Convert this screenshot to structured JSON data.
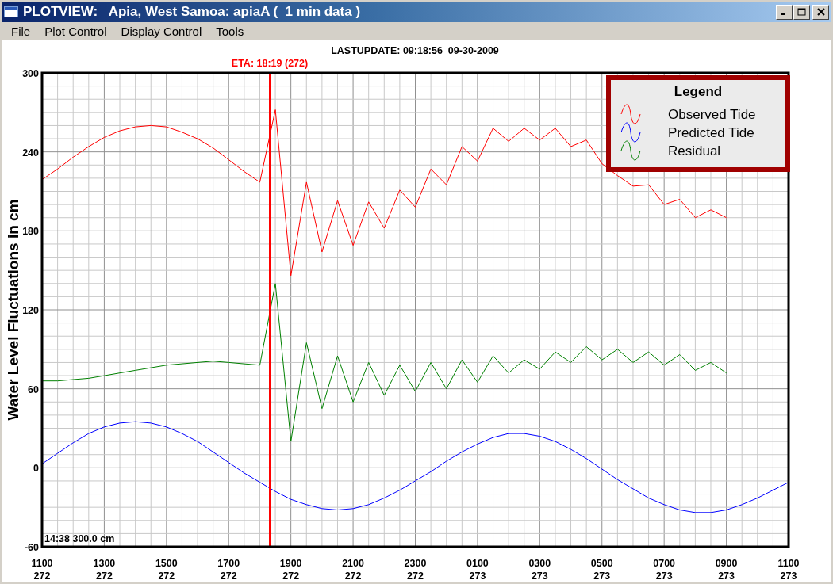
{
  "window": {
    "title": "PLOTVIEW:   Apia, West Samoa: apiaA (  1 min data )"
  },
  "menu": [
    {
      "label": "File"
    },
    {
      "label": "Plot Control"
    },
    {
      "label": "Display Control"
    },
    {
      "label": "Tools"
    }
  ],
  "chart": {
    "readout": "14:38 300.0 cm",
    "legend_title": "Legend",
    "chart_data": {
      "type": "line",
      "title": "LASTUPDATE: 09:18:56  09-30-2009",
      "ylabel": "Water Level Fluctuations in cm",
      "categories": [
        "1100\n272",
        null,
        null,
        null,
        "1300\n272",
        null,
        null,
        null,
        "1500\n272",
        null,
        null,
        null,
        "1700\n272",
        null,
        null,
        null,
        "1900\n272",
        null,
        null,
        null,
        "2100\n272",
        null,
        null,
        null,
        "2300\n272",
        null,
        null,
        null,
        "0100\n273",
        null,
        null,
        null,
        "0300\n273",
        null,
        null,
        null,
        "0500\n273",
        null,
        null,
        null,
        "0700\n273",
        null,
        null,
        null,
        "0900\n273",
        null,
        null,
        null,
        "1100\n273"
      ],
      "series": [
        {
          "name": "Observed Tide",
          "color": "#ff0000",
          "values": [
            219,
            227,
            236,
            244,
            251,
            256,
            259,
            260,
            259,
            255,
            250,
            243,
            234,
            225,
            217,
            272,
            146,
            217,
            164,
            203,
            169,
            202,
            182,
            211,
            198,
            227,
            215,
            244,
            233,
            258,
            248,
            258,
            249,
            258,
            244,
            249,
            231,
            222,
            214,
            215,
            200,
            204,
            190,
            196,
            190,
            null,
            null,
            null,
            null
          ]
        },
        {
          "name": "Predicted Tide",
          "color": "#0000ff",
          "values": [
            3,
            11,
            19,
            26,
            31,
            34,
            35,
            34,
            31,
            26,
            20,
            12,
            4,
            -4,
            -11,
            -18,
            -24,
            -28,
            -31,
            -32,
            -31,
            -28,
            -23,
            -17,
            -10,
            -3,
            5,
            12,
            18,
            23,
            26,
            26,
            24,
            20,
            14,
            7,
            -1,
            -9,
            -16,
            -23,
            -28,
            -32,
            -34,
            -34,
            -32,
            -28,
            -23,
            -17,
            -11
          ]
        },
        {
          "name": "Residual",
          "color": "#008000",
          "values": [
            66,
            66,
            67,
            68,
            70,
            72,
            74,
            76,
            78,
            79,
            80,
            81,
            80,
            79,
            78,
            140,
            20,
            95,
            45,
            85,
            50,
            80,
            55,
            78,
            58,
            80,
            60,
            82,
            65,
            85,
            72,
            82,
            75,
            88,
            80,
            92,
            82,
            90,
            80,
            88,
            78,
            86,
            74,
            80,
            72,
            null,
            null,
            null,
            null
          ]
        }
      ],
      "ylim": [
        -60,
        300
      ],
      "yticks": [
        -60,
        0,
        60,
        120,
        180,
        240,
        300
      ],
      "grid": true,
      "legend": "upper right",
      "annotations": [
        "ETA: 18:19 (272)"
      ]
    }
  }
}
